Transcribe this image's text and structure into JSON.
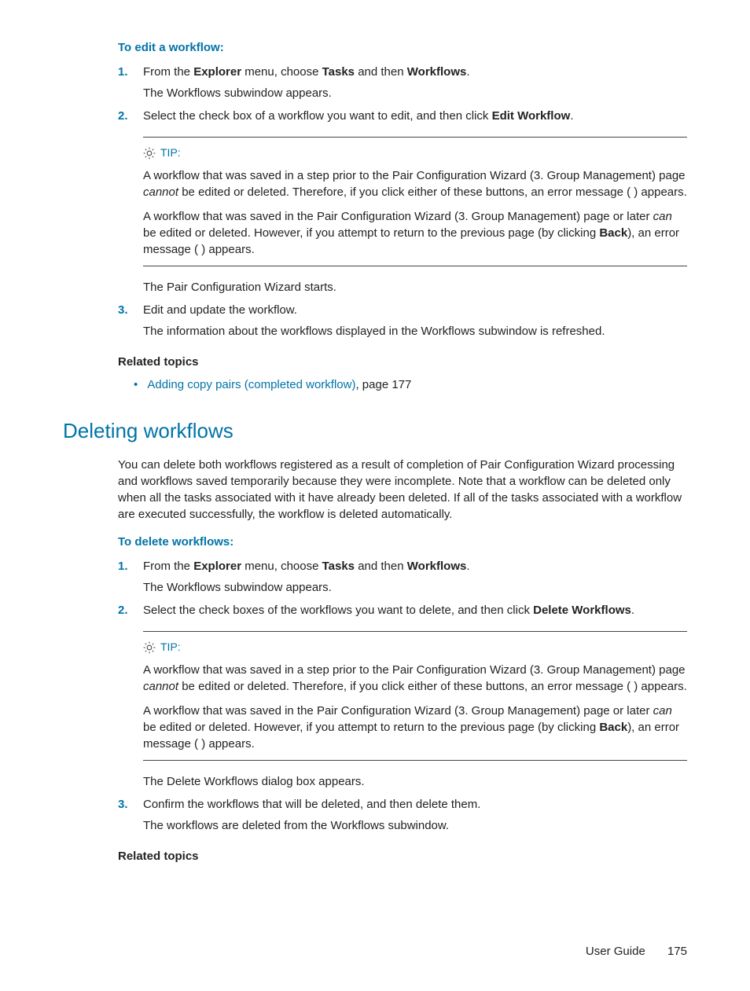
{
  "editSection": {
    "heading": "To edit a workflow:",
    "steps": [
      {
        "num": "1.",
        "line1_pre": "From the ",
        "line1_b1": "Explorer",
        "line1_mid1": " menu, choose ",
        "line1_b2": "Tasks",
        "line1_mid2": " and then ",
        "line1_b3": "Workflows",
        "line1_post": ".",
        "line2": "The Workflows subwindow appears."
      },
      {
        "num": "2.",
        "line1_pre": "Select the check box of a workflow you want to edit, and then click ",
        "line1_b1": "Edit Workflow",
        "line1_post": ".",
        "afterTip1": "The Pair Configuration Wizard starts."
      },
      {
        "num": "3.",
        "line1": "Edit and update the workflow.",
        "line2": "The information about the workflows displayed in the Workflows subwindow is refreshed."
      }
    ],
    "tip": {
      "label": "TIP:",
      "p1_pre": "A workflow that was saved in a step prior to the Pair Configuration Wizard (3. Group Management) page ",
      "p1_it": "cannot",
      "p1_post": " be edited or deleted. Therefore, if you click either of these buttons, an error message (                    ) appears.",
      "p2_pre": "A workflow that was saved in the Pair Configuration Wizard (3. Group Management) page or later ",
      "p2_it": "can",
      "p2_mid": " be edited or deleted. However, if you attempt to return to the previous page (by clicking ",
      "p2_b": "Back",
      "p2_post": "), an error message (                    ) appears."
    },
    "relatedHeading": "Related topics",
    "relatedLink": "Adding copy pairs (completed workflow)",
    "relatedPage": ", page 177"
  },
  "deleteSection": {
    "title": "Deleting workflows",
    "intro": "You can delete both workflows registered as a result of completion of Pair Configuration Wizard processing and workflows saved temporarily because they were incomplete. Note that a workflow can be deleted only when all the tasks associated with it have already been deleted. If all of the tasks associated with a workflow are executed successfully, the workflow is deleted automatically.",
    "heading": "To delete workflows:",
    "steps": [
      {
        "num": "1.",
        "line1_pre": "From the ",
        "line1_b1": "Explorer",
        "line1_mid1": " menu, choose ",
        "line1_b2": "Tasks",
        "line1_mid2": " and then ",
        "line1_b3": "Workflows",
        "line1_post": ".",
        "line2": "The Workflows subwindow appears."
      },
      {
        "num": "2.",
        "line1_pre": "Select the check boxes of the workflows you want to delete, and then click ",
        "line1_b1": "Delete Workflows",
        "line1_post": ".",
        "afterTip1": "The Delete Workflows dialog box appears."
      },
      {
        "num": "3.",
        "line1": "Confirm the workflows that will be deleted, and then delete them.",
        "line2": "The workflows are deleted from the Workflows subwindow."
      }
    ],
    "tip": {
      "label": "TIP:",
      "p1_pre": "A workflow that was saved in a step prior to the Pair Configuration Wizard (3. Group Management) page ",
      "p1_it": "cannot",
      "p1_post": " be edited or deleted. Therefore, if you click either of these buttons, an error message (                    ) appears.",
      "p2_pre": "A workflow that was saved in the Pair Configuration Wizard (3. Group Management) page or later ",
      "p2_it": "can",
      "p2_mid": " be edited or deleted. However, if you attempt to return to the previous page (by clicking ",
      "p2_b": "Back",
      "p2_post": "), an error message (                    ) appears."
    },
    "relatedHeading": "Related topics"
  },
  "footer": {
    "label": "User Guide",
    "page": "175"
  }
}
